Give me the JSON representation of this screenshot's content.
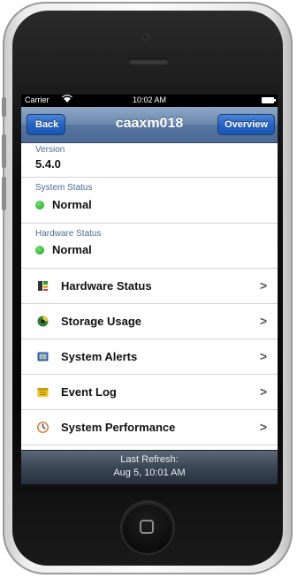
{
  "status_bar": {
    "carrier": "Carrier",
    "time": "10:02 AM"
  },
  "navbar": {
    "back_label": "Back",
    "title": "caaxm018",
    "overview_label": "Overview"
  },
  "info": [
    {
      "label": "Version",
      "value": "5.4.0",
      "status_dot": false
    },
    {
      "label": "System Status",
      "value": "Normal",
      "status_dot": true,
      "status_color": "#22b822"
    },
    {
      "label": "Hardware Status",
      "value": "Normal",
      "status_dot": true,
      "status_color": "#22b822"
    }
  ],
  "menu": [
    {
      "label": "Hardware Status",
      "icon": "hardware-icon"
    },
    {
      "label": "Storage Usage",
      "icon": "storage-icon"
    },
    {
      "label": "System Alerts",
      "icon": "alerts-icon"
    },
    {
      "label": "Event Log",
      "icon": "event-log-icon"
    },
    {
      "label": "System Performance",
      "icon": "performance-icon"
    }
  ],
  "footer": {
    "refresh_label": "Last Refresh:",
    "refresh_value": "Aug 5, 10:01 AM"
  },
  "colors": {
    "navbar": "#5776a0",
    "button": "#2563c4",
    "label": "#4a6d98",
    "status_ok": "#22b822"
  }
}
